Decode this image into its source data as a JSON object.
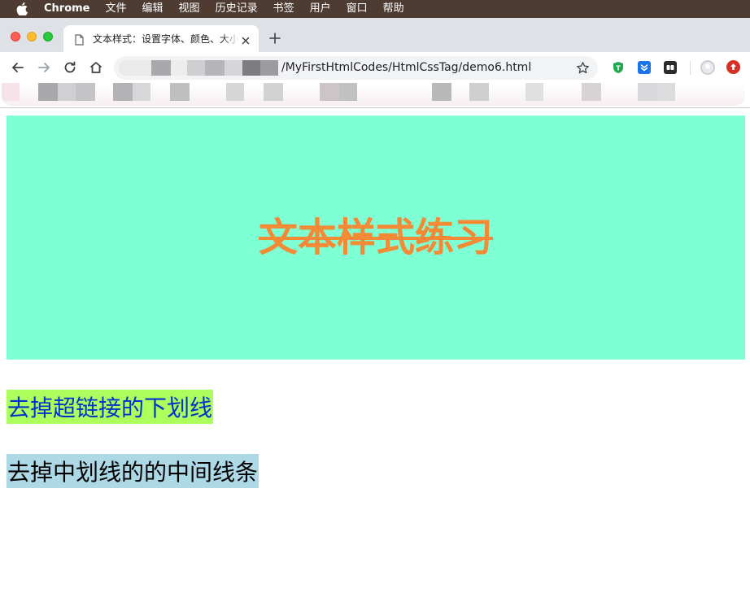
{
  "menubar": {
    "items": [
      "Chrome",
      "文件",
      "编辑",
      "视图",
      "历史记录",
      "书签",
      "用户",
      "窗口",
      "帮助"
    ]
  },
  "tab": {
    "title": "文本样式：设置字体、颜色、大小"
  },
  "toolbar": {
    "url": "/MyFirstHtmlCodes/HtmlCssTag/demo6.html"
  },
  "page": {
    "heading": "文本样式练习",
    "link_text": "去掉超链接的下划线",
    "strike_text": "去掉中划线的的中间线条"
  },
  "colors": {
    "hero_bg": "#7fffd4",
    "heading": "#f58a36",
    "link_bg": "#adff5e",
    "link_text": "#0033cc",
    "strike_bg": "#add8e6"
  }
}
